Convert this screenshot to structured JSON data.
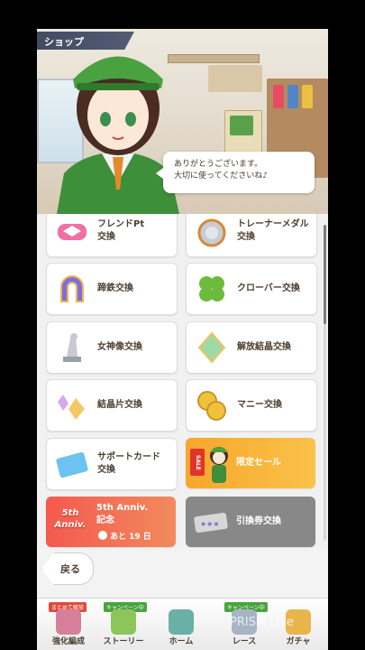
{
  "header": {
    "title": "ショップ"
  },
  "bubble": {
    "line1": "ありがとうございます。",
    "line2": "大切に使ってくださいね♪"
  },
  "shop_items": [
    {
      "id": "friend-pt",
      "line1": "フレンドPt",
      "line2": "交換"
    },
    {
      "id": "trainer-medal",
      "line1": "トレーナーメダル",
      "line2": "交換"
    },
    {
      "id": "horseshoe",
      "line1": "蹄鉄交換",
      "line2": ""
    },
    {
      "id": "clover",
      "line1": "クローバー交換",
      "line2": ""
    },
    {
      "id": "goddess",
      "line1": "女神像交換",
      "line2": ""
    },
    {
      "id": "release-crystal",
      "line1": "解放結晶交換",
      "line2": ""
    },
    {
      "id": "crystal-shard",
      "line1": "結晶片交換",
      "line2": ""
    },
    {
      "id": "money",
      "line1": "マニー交換",
      "line2": ""
    },
    {
      "id": "support-card",
      "line1": "サポートカード",
      "line2": "交換"
    },
    {
      "id": "limited-sale",
      "line1": "限定セール",
      "line2": ""
    },
    {
      "id": "anniv",
      "line1": "5th Anniv.",
      "line2": "記念",
      "remaining": "あと 19 日"
    },
    {
      "id": "voucher",
      "line1": "引換券交換",
      "line2": ""
    }
  ],
  "badges": {
    "anniv_logo": "5th Anniv.",
    "sale": "SALE"
  },
  "back_button": {
    "label": "戻る"
  },
  "nav": [
    {
      "label": "強化編成",
      "tag": "まとめて解放"
    },
    {
      "label": "ストーリー",
      "tag": "キャンペーン中"
    },
    {
      "label": "ホーム",
      "tag": ""
    },
    {
      "label": "レース",
      "tag": "キャンペーン中"
    },
    {
      "label": "ガチャ",
      "tag": ""
    }
  ],
  "watermark": "PRISM Live",
  "colors": {
    "accent_green": "#3f9b3a",
    "anniv_red": "#f4594f",
    "sale_orange": "#f7a62c"
  }
}
